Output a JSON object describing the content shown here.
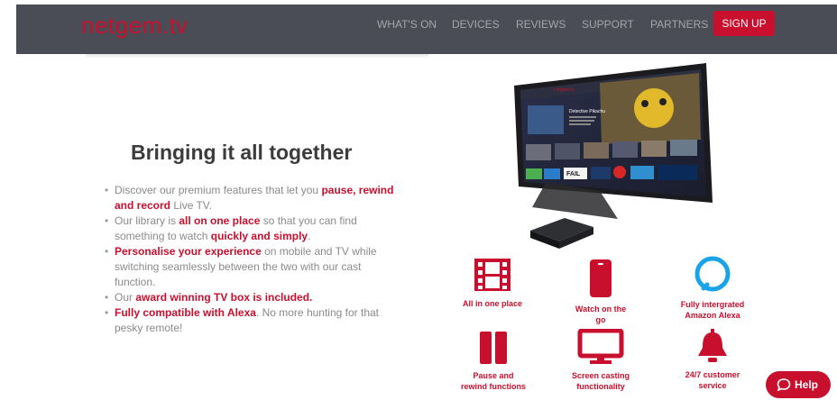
{
  "header": {
    "logo": "netgem.tv",
    "nav": [
      "WHAT'S ON",
      "DEVICES",
      "REVIEWS",
      "SUPPORT",
      "PARTNERS"
    ],
    "signup": "SIGN UP"
  },
  "main": {
    "title": "Bringing it all together",
    "features": [
      [
        {
          "t": "Discover our premium features that let you "
        },
        {
          "t": "pause, rewind and record",
          "h": true
        },
        {
          "t": " Live TV."
        }
      ],
      [
        {
          "t": "Our library is "
        },
        {
          "t": "all on one place",
          "h": true
        },
        {
          "t": " so that you can find something to watch "
        },
        {
          "t": "quickly and simply",
          "h": true
        },
        {
          "t": "."
        }
      ],
      [
        {
          "t": "Personalise your experience",
          "h": true
        },
        {
          "t": " on mobile and TV while switching seamlessly between the two with our cast function."
        }
      ],
      [
        {
          "t": "Our "
        },
        {
          "t": "award winning TV box is included.",
          "h": true
        }
      ],
      [
        {
          "t": "Fully compatible with Alexa",
          "h": true
        },
        {
          "t": ". No more hunting for that pesky remote!"
        }
      ]
    ]
  },
  "features_grid": [
    {
      "label": "All in one place",
      "icon": "film-icon"
    },
    {
      "label": "Watch on the go",
      "icon": "phone-icon"
    },
    {
      "label": "Fully intergrated Amazon Alexa",
      "icon": "alexa-ring-icon"
    },
    {
      "label": "Pause and rewind functions",
      "icon": "pause-icon"
    },
    {
      "label": "Screen casting functionality",
      "icon": "monitor-icon"
    },
    {
      "label": "24/7 customer service",
      "icon": "bell-icon"
    }
  ],
  "tv_screen": {
    "brand": "netgem.tv",
    "show_title": "Detective Pikachu",
    "tiles": [
      "FAIL",
      "Sports",
      "Global"
    ]
  },
  "help": "Help",
  "colors": {
    "accent": "#c8102e",
    "nav_bg": "#4a4d55"
  }
}
